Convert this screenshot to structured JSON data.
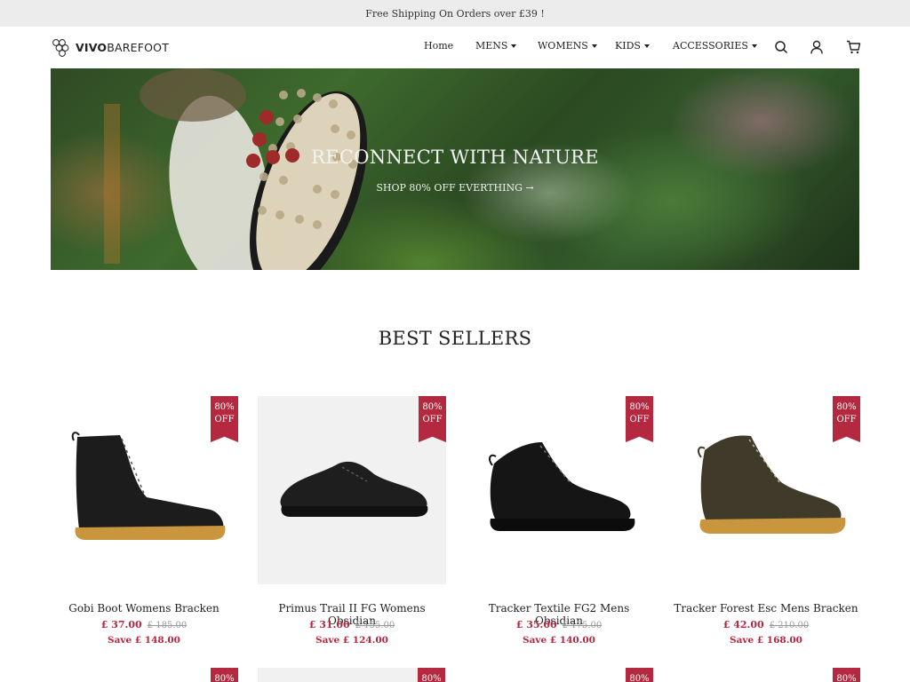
{
  "announcement": "Free Shipping On Orders over £39 !",
  "brand": {
    "name_bold": "VIVO",
    "name_rest": "BAREFOOT"
  },
  "nav": [
    {
      "label": "Home",
      "has_caret": false
    },
    {
      "label": "MENS",
      "has_caret": true
    },
    {
      "label": "WOMENS",
      "has_caret": true
    },
    {
      "label": "KIDS",
      "has_caret": true
    },
    {
      "label": "ACCESSORIES",
      "has_caret": true
    }
  ],
  "header_icons": [
    "search-icon",
    "account-icon",
    "cart-icon"
  ],
  "hero": {
    "title": "RECONNECT WITH NATURE",
    "link": "SHOP 80% OFF EVERTHING →"
  },
  "section_title": "BEST SELLERS",
  "badge_line1": "80%",
  "badge_line2": "OFF",
  "products": [
    {
      "name": "Gobi Boot Womens Bracken",
      "price": "£ 37.00",
      "old_price": "£ 185.00",
      "save": "Save £ 148.00",
      "shoe": "tall-boot-black"
    },
    {
      "name": "Primus Trail II FG Womens Obsidian",
      "price": "£ 31.00",
      "old_price": "£ 155.00",
      "save": "Save £ 124.00",
      "shoe": "trail-shoe-black"
    },
    {
      "name": "Tracker Textile FG2 Mens Obsidian",
      "price": "£ 35.00",
      "old_price": "£ 175.00",
      "save": "Save £ 140.00",
      "shoe": "hiking-boot-black"
    },
    {
      "name": "Tracker Forest Esc Mens Bracken",
      "price": "£ 42.00",
      "old_price": "£ 210.00",
      "save": "Save £ 168.00",
      "shoe": "hiking-boot-brown"
    }
  ],
  "colors": {
    "accent": "#b42940",
    "announce_bg": "#ececec",
    "gum_sole": "#c9953d"
  }
}
